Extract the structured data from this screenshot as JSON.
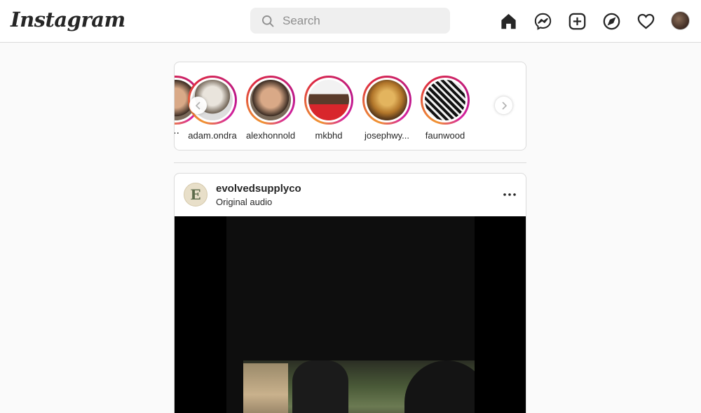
{
  "app": {
    "logo_text": "Instagram"
  },
  "search": {
    "placeholder": "Search"
  },
  "nav_icons": [
    "home-icon",
    "messenger-icon",
    "new-post-icon",
    "explore-icon",
    "activity-heart-icon",
    "profile-avatar"
  ],
  "stories": {
    "partial_label": "..",
    "items": [
      {
        "username": "adam.ondra"
      },
      {
        "username": "alexhonnold"
      },
      {
        "username": "mkbhd"
      },
      {
        "username": "josephwy..."
      },
      {
        "username": "faunwood"
      }
    ]
  },
  "post": {
    "username": "evolvedsupplyco",
    "subtitle": "Original audio",
    "avatar_letter": "E"
  },
  "colors": {
    "story_ring": [
      "#f09433",
      "#dc2743",
      "#bc1888"
    ],
    "border": "#dbdbdb",
    "background": "#fafafa"
  }
}
